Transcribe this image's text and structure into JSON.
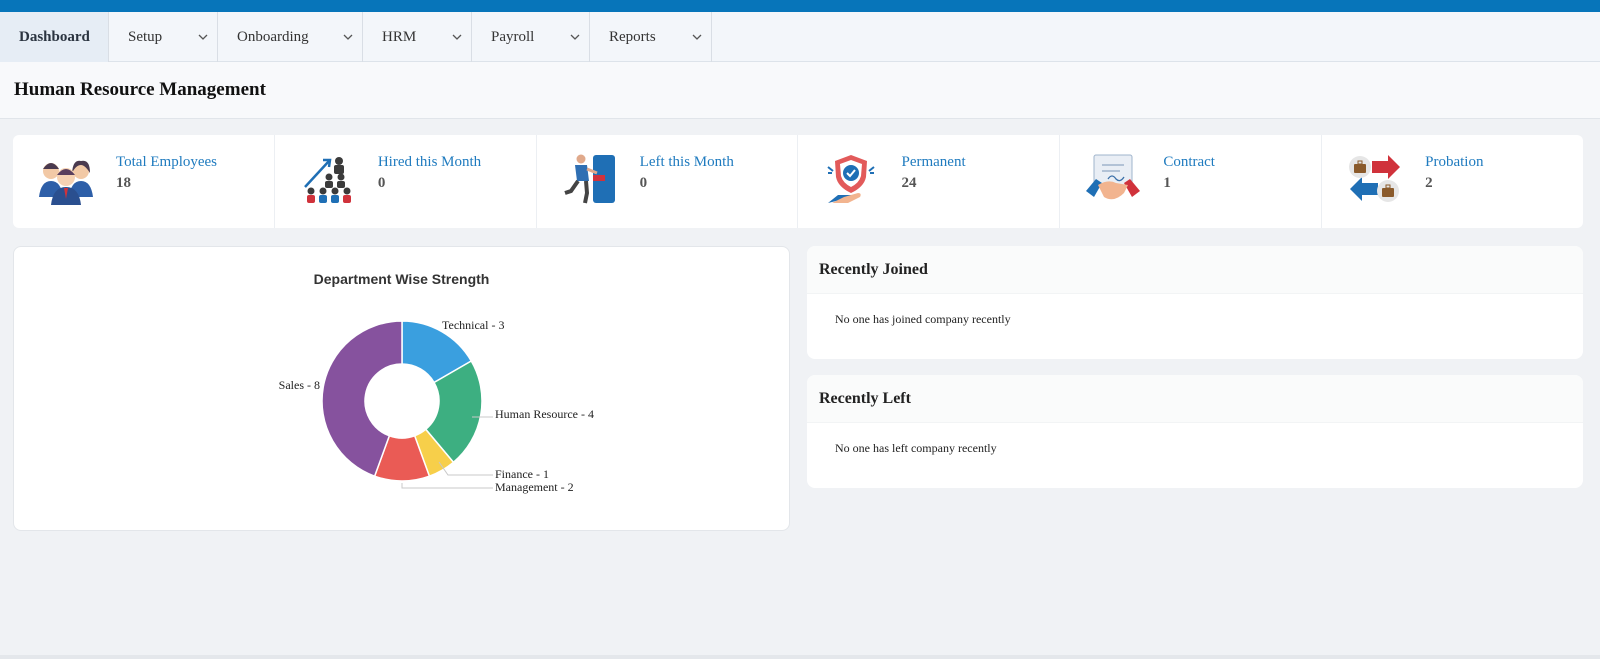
{
  "nav": {
    "items": [
      {
        "label": "Dashboard",
        "active": true
      },
      {
        "label": "Setup"
      },
      {
        "label": "Onboarding"
      },
      {
        "label": "HRM"
      },
      {
        "label": "Payroll"
      },
      {
        "label": "Reports"
      }
    ]
  },
  "page": {
    "title": "Human Resource Management"
  },
  "stats": [
    {
      "label": "Total Employees",
      "value": "18",
      "icon": "employees-icon"
    },
    {
      "label": "Hired this Month",
      "value": "0",
      "icon": "hired-icon"
    },
    {
      "label": "Left this Month",
      "value": "0",
      "icon": "exit-door-icon"
    },
    {
      "label": "Permanent",
      "value": "24",
      "icon": "shield-hand-icon"
    },
    {
      "label": "Contract",
      "value": "1",
      "icon": "handshake-icon"
    },
    {
      "label": "Probation",
      "value": "2",
      "icon": "briefcase-arrows-icon"
    }
  ],
  "chart_data": {
    "type": "pie",
    "donut": true,
    "title": "Department Wise Strength",
    "labels": [
      "Technical",
      "Human Resource",
      "Finance",
      "Management",
      "Sales"
    ],
    "values": [
      3,
      4,
      1,
      2,
      8
    ],
    "colors": [
      "#3a9fdf",
      "#3daf81",
      "#f7cf4a",
      "#ea5b55",
      "#86529e"
    ],
    "slice_labels": [
      "Technical - 3",
      "Human Resource - 4",
      "Finance - 1",
      "Management - 2",
      "Sales - 8"
    ]
  },
  "recently_joined": {
    "title": "Recently Joined",
    "message": "No one has joined company recently"
  },
  "recently_left": {
    "title": "Recently Left",
    "message": "No one has left company recently"
  },
  "colors": {
    "brand": "#0775ba",
    "link": "#1f7bbf"
  }
}
